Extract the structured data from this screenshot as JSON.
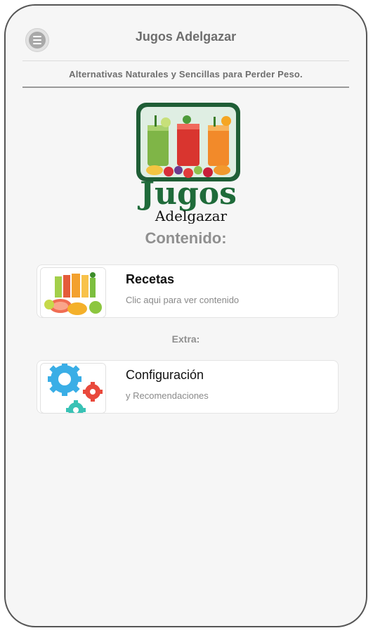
{
  "header": {
    "title": "Jugos Adelgazar",
    "menu_icon": "hamburger-menu-icon"
  },
  "subheader": {
    "text": "Alternativas Naturales y Sencillas para Perder Peso."
  },
  "logo": {
    "title": "Jugos",
    "subtitle": "Adelgazar"
  },
  "content": {
    "section_title": "Contenido:",
    "extra_label": "Extra:",
    "items": [
      {
        "title": "Recetas",
        "description": "Clic aqui para ver contenido",
        "icon": "juice-glasses-image"
      },
      {
        "title": "Configuración",
        "description": "y Recomendaciones",
        "icon": "gears-icon"
      }
    ]
  },
  "colors": {
    "logo_green": "#1f6b3a",
    "gear_blue": "#3aaee6",
    "gear_red": "#e9493c",
    "gear_teal": "#38c2b5"
  }
}
